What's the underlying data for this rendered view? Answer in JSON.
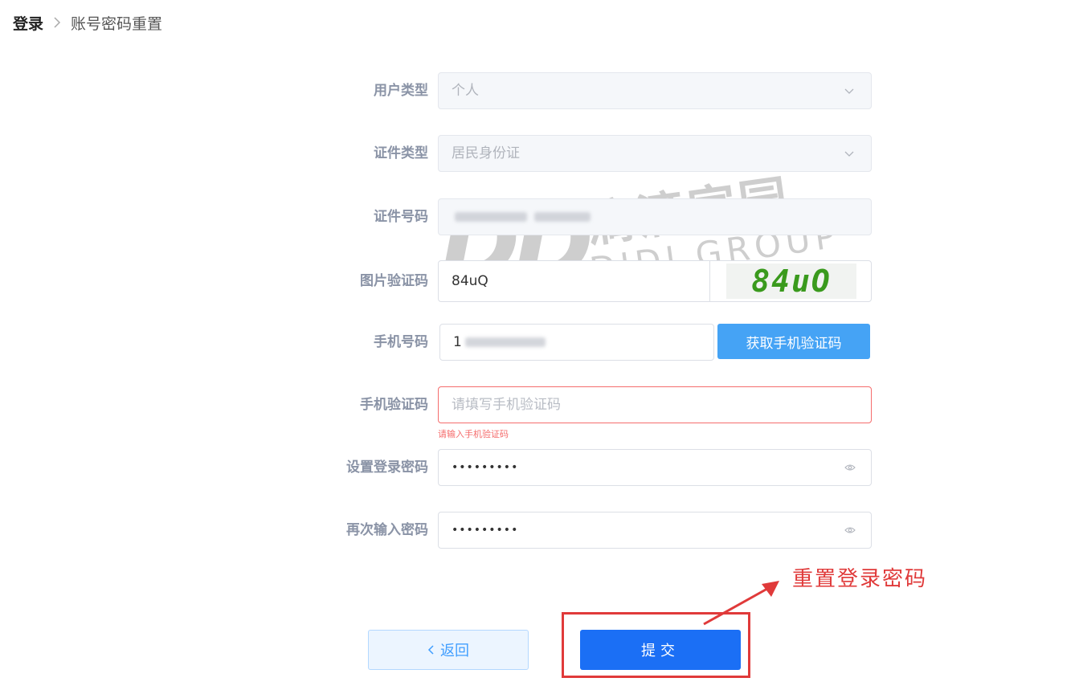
{
  "breadcrumb": {
    "home": "登录",
    "current": "账号密码重置"
  },
  "form": {
    "user_type": {
      "label": "用户类型",
      "value": "个人"
    },
    "id_type": {
      "label": "证件类型",
      "value": "居民身份证"
    },
    "id_number": {
      "label": "证件号码"
    },
    "captcha": {
      "label": "图片验证码",
      "value": "84uQ",
      "image_text": "84uO"
    },
    "phone": {
      "label": "手机号码",
      "value_prefix": "1",
      "send_code_button": "获取手机验证码"
    },
    "sms_code": {
      "label": "手机验证码",
      "placeholder": "请填写手机验证码",
      "error": "请输入手机验证码"
    },
    "password": {
      "label": "设置登录密码",
      "masked": "•••••••••"
    },
    "confirm_password": {
      "label": "再次输入密码",
      "masked": "•••••••••"
    }
  },
  "watermark": {
    "logo": "DD",
    "cn": "滴滴家园",
    "en": "DIDI GROUP"
  },
  "actions": {
    "back": "返回",
    "submit": "提交"
  },
  "annotation": {
    "text": "重置登录密码",
    "color": "#e03a3a"
  },
  "colors": {
    "primary": "#1b6ff5",
    "sms_button": "#45a3f5",
    "error": "#f56c6c"
  }
}
